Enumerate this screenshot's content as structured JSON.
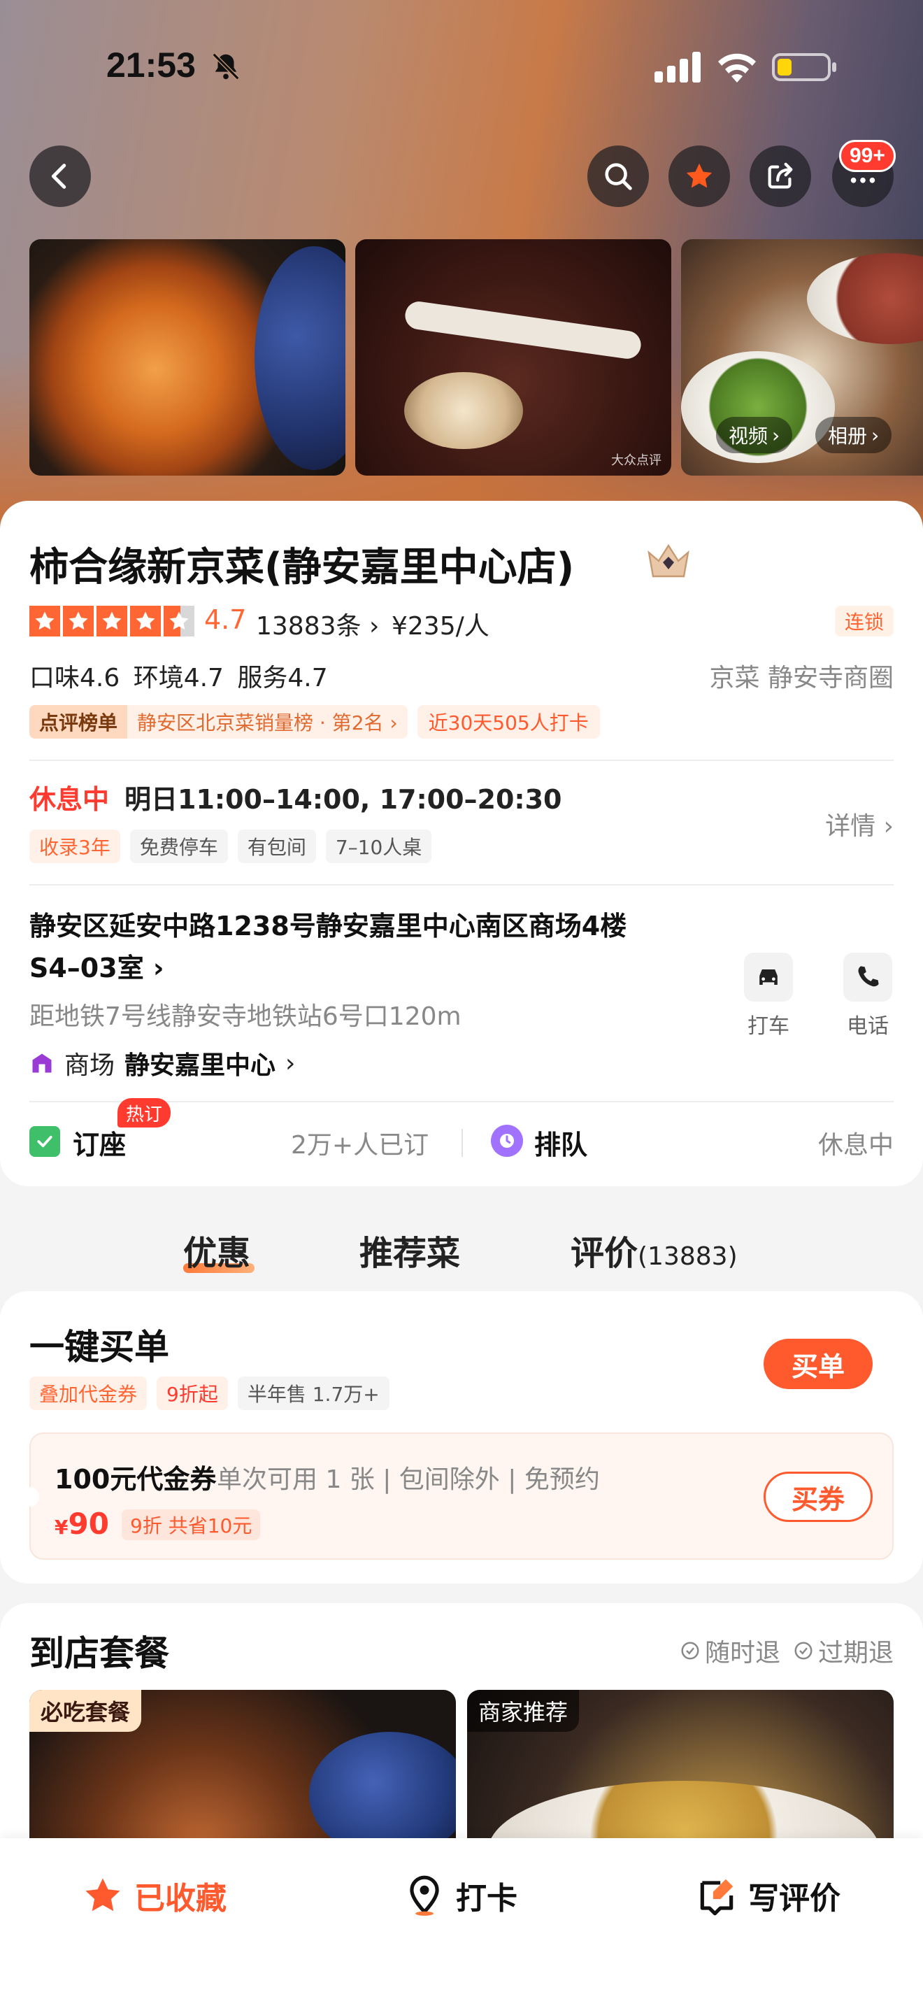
{
  "status_bar": {
    "time": "21:53"
  },
  "header": {
    "notification_badge": "99+"
  },
  "gallery": {
    "watermark": "大众点评",
    "video_label": "视频",
    "album_label": "相册"
  },
  "shop": {
    "name": "柿合缘新京菜(静安嘉里中心店)",
    "rating": "4.7",
    "stars": 4.5,
    "review_count": "13883条",
    "price_per_person": "¥235/人",
    "chain_tag": "连锁",
    "scores": "口味4.6 环境4.7 服务4.7",
    "cuisine": "京菜 静安寺商圈",
    "rank_label": "点评榜单",
    "rank_text": "静安区北京菜销量榜 · 第2名",
    "checkin_text": "近30天505人打卡"
  },
  "hours": {
    "status": "休息中",
    "time": "明日11:00–14:00, 17:00–20:30",
    "details_link": "详情",
    "tags": [
      "收录3年",
      "免费停车",
      "有包间",
      "7–10人桌"
    ]
  },
  "location": {
    "address": "静安区延安中路1238号静安嘉里中心南区商场4楼S4–03室",
    "metro": "距地铁7号线静安寺地铁站6号口120m",
    "mall_label": "商场",
    "mall_name": "静安嘉里中心",
    "taxi_label": "打车",
    "phone_label": "电话"
  },
  "booking": {
    "book_label": "订座",
    "hot_badge": "热订",
    "booked_count": "2万+人已订",
    "queue_label": "排队",
    "queue_status": "休息中"
  },
  "tabs": {
    "deals": "优惠",
    "dishes": "推荐菜",
    "reviews": "评价",
    "reviews_count": "(13883)"
  },
  "deal": {
    "title": "一键买单",
    "tags": [
      "叠加代金券",
      "9折起",
      "半年售 1.7万+"
    ],
    "buy_button": "买单",
    "voucher_title": "100元代金券",
    "voucher_desc": "单次可用 1 张 | 包间除外 | 免预约",
    "voucher_currency": "¥",
    "voucher_price": "90",
    "voucher_discount": "9折 共省10元",
    "voucher_button": "买券"
  },
  "package": {
    "title": "到店套餐",
    "policy_1": "随时退",
    "policy_2": "过期退",
    "badge_1": "必吃套餐",
    "badge_2": "商家推荐"
  },
  "bottom_bar": {
    "favorite": "已收藏",
    "checkin": "打卡",
    "write_review": "写评价"
  },
  "colors": {
    "accent": "#ff5a2e",
    "rating": "#ff6633",
    "closed": "#ff3b30"
  }
}
